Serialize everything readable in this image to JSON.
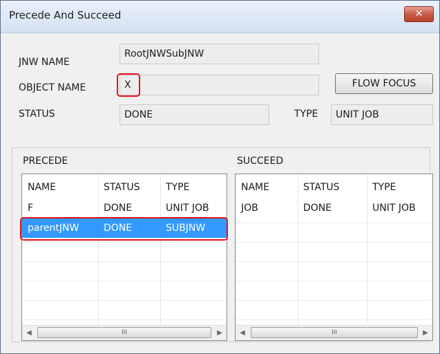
{
  "window": {
    "title": "Precede And Succeed",
    "close_label": "✕"
  },
  "form": {
    "jnw_name_label": "JNW NAME",
    "jnw_name_value": "RootJNWSubJNW",
    "object_name_label": "OBJECT NAME",
    "object_name_value": "X",
    "flow_focus_label": "FLOW FOCUS",
    "status_label": "STATUS",
    "status_value": "DONE",
    "type_label": "TYPE",
    "type_value": "UNIT JOB"
  },
  "precede": {
    "title": "PRECEDE",
    "columns": [
      "NAME",
      "STATUS",
      "TYPE"
    ],
    "rows": [
      [
        "F",
        "DONE",
        "UNIT JOB"
      ],
      [
        "parentJNW",
        "DONE",
        "SUBJNW"
      ]
    ],
    "selected_row": 1
  },
  "succeed": {
    "title": "SUCCEED",
    "columns": [
      "NAME",
      "STATUS",
      "TYPE"
    ],
    "rows": [
      [
        "JOB",
        "DONE",
        "UNIT JOB"
      ]
    ]
  },
  "scrollbar": {
    "left_icon": "arrow-left-icon",
    "right_icon": "arrow-right-icon",
    "thumb_grip": "III"
  },
  "colors": {
    "selection": "#3399ff",
    "highlight": "#e8101b",
    "close_button": "#c75a45"
  }
}
